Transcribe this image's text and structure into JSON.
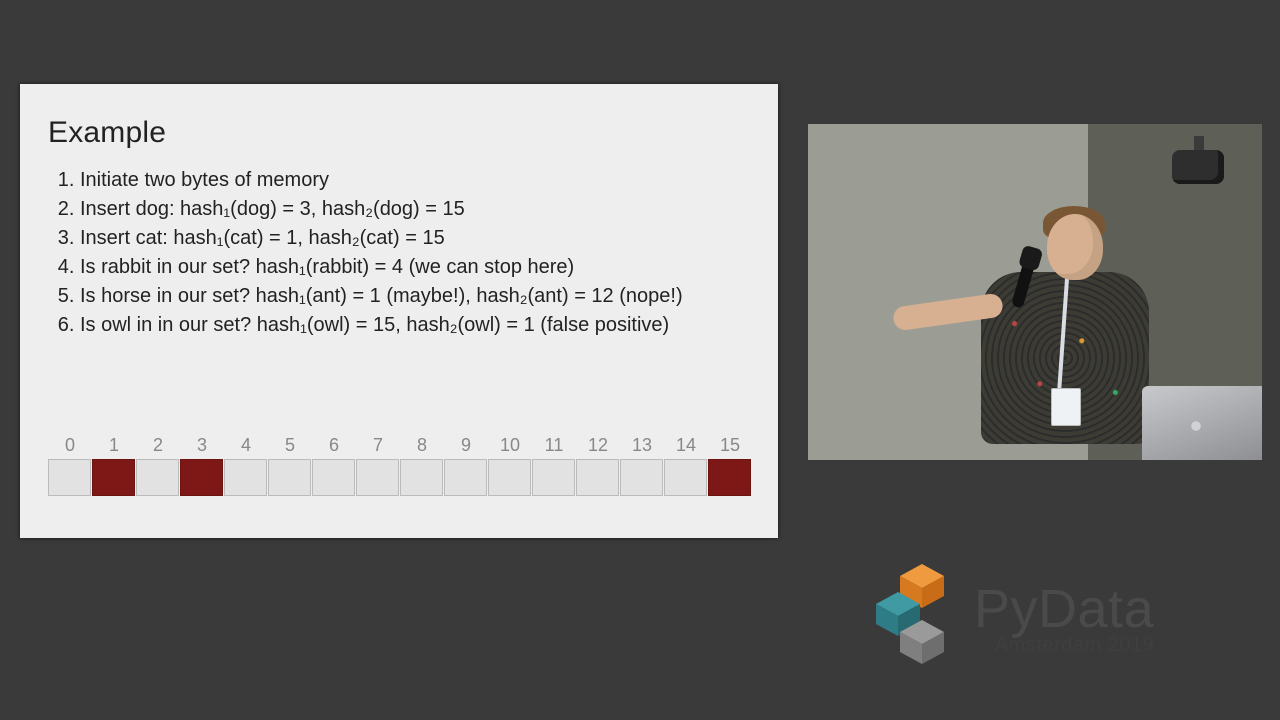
{
  "slide": {
    "title": "Example",
    "items": [
      "Initiate two bytes of memory",
      "Insert dog: hash₁(dog) = 3, hash₂(dog) = 15",
      "Insert cat: hash₁(cat) = 1, hash₂(cat) = 15",
      "Is rabbit in our set? hash₁(rabbit) = 4 (we can stop here)",
      "Is horse in our set? hash₁(ant) = 1 (maybe!), hash₂(ant) = 12 (nope!)",
      "Is owl in in our set? hash₁(owl) = 15, hash₂(owl) = 1 (false positive)"
    ],
    "bits": {
      "labels": [
        "0",
        "1",
        "2",
        "3",
        "4",
        "5",
        "6",
        "7",
        "8",
        "9",
        "10",
        "11",
        "12",
        "13",
        "14",
        "15"
      ],
      "on_indices": [
        1,
        3,
        15
      ]
    }
  },
  "logo": {
    "brand_py": "Py",
    "brand_data": "Data",
    "subtitle": "Amsterdam 2019",
    "colors": {
      "orange": "#e88a2e",
      "teal": "#3a8a92",
      "gray": "#8f8f8f"
    }
  }
}
